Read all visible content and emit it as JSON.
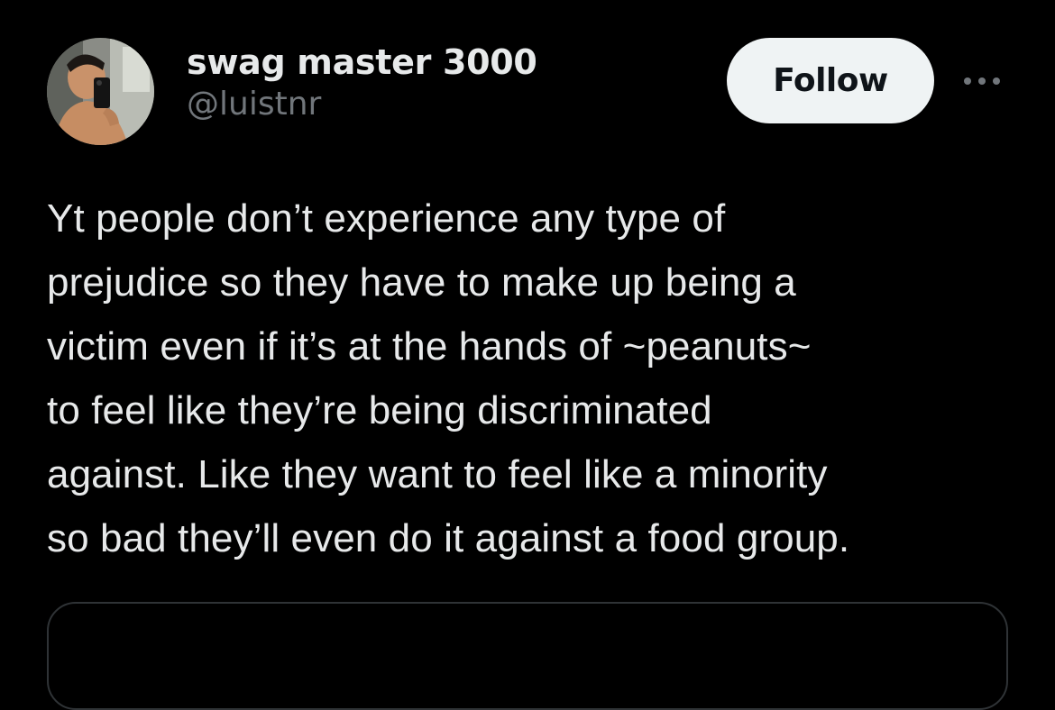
{
  "user": {
    "display_name": "swag master 3000",
    "handle": "@luistnr",
    "avatar_icon": "profile-photo"
  },
  "actions": {
    "follow_label": "Follow",
    "more_icon": "ellipsis-icon"
  },
  "tweet": {
    "text_lines": [
      "Yt people don’t experience any type of",
      "prejudice so they have to make up being a",
      "victim even if it’s at the hands of ~peanuts~",
      "to feel like they’re being discriminated",
      "against. Like they want to feel like a minority",
      "so bad they’ll even do it against a food group."
    ]
  },
  "colors": {
    "background": "#000000",
    "text_primary": "#e7e9ea",
    "text_secondary": "#71767b",
    "follow_bg": "#eff3f4",
    "follow_text": "#0f1419",
    "border": "#2f3336"
  }
}
